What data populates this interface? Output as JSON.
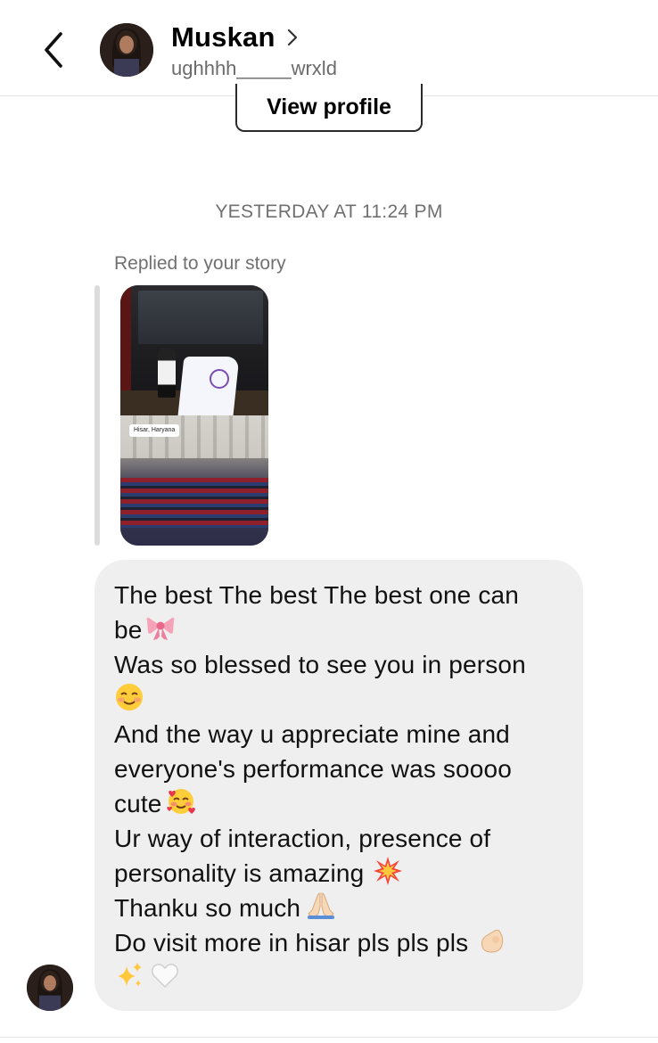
{
  "header": {
    "name": "Muskan",
    "username": "ughhhh_____wrxld",
    "back_icon": "chevron-left-icon",
    "name_chevron_icon": "chevron-right-icon"
  },
  "profile_button": {
    "label": "View profile"
  },
  "thread": {
    "timestamp": "YESTERDAY AT 11:24 PM",
    "reply_note": "Replied to your story",
    "story": {
      "location_tag": "Hisar, Haryana"
    },
    "message": {
      "lines": [
        "The best The best The best one can",
        "be",
        "Was so blessed to see you in person",
        "",
        "And the way u appreciate mine and",
        "everyone's performance was soooo",
        "cute",
        "Ur way of interaction, presence of",
        "personality is amazing",
        "Thanku so much",
        "Do visit more in hisar pls pls pls",
        ""
      ],
      "emoji_names": [
        "ribbon-emoji",
        "smiling-face-emoji",
        "smiling-face-with-hearts-emoji",
        "collision-emoji",
        "folded-hands-emoji",
        "pinching-hand-emoji",
        "sparkles-emoji",
        "white-heart-emoji"
      ]
    }
  },
  "colors": {
    "bubble": "#efefef",
    "secondary_text": "#707070",
    "divider": "#e3e3e3"
  }
}
